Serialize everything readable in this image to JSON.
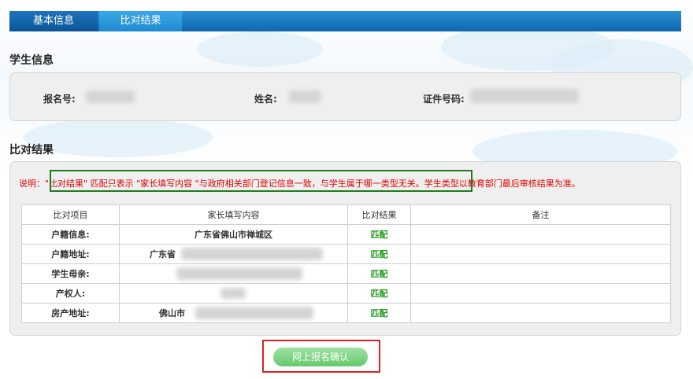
{
  "tabs": {
    "basic_info": "基本信息",
    "compare_result": "比对结果"
  },
  "student_info": {
    "title": "学生信息",
    "reg_no_label": "报名号:",
    "name_label": "姓名:",
    "id_label": "证件号码:"
  },
  "compare": {
    "title": "比对结果",
    "notice_prefix": "说明：",
    "notice_highlight": "\"比对结果\" 匹配只表示 \"家长填写内容 \"与政府相关部门登记信息一致，与学生属于哪一类型无关。",
    "notice_suffix": "学生类型以教育部门最后审核结果为准。",
    "headers": [
      "比对项目",
      "家长填写内容",
      "比对结果",
      "备注"
    ],
    "rows": [
      {
        "item": "户籍信息:",
        "content": "广东省佛山市禅城区",
        "result": "匹配",
        "note": ""
      },
      {
        "item": "户籍地址:",
        "content": "广东省",
        "result": "匹配",
        "note": ""
      },
      {
        "item": "学生母亲:",
        "content": "",
        "result": "匹配",
        "note": ""
      },
      {
        "item": "产权人:",
        "content": "",
        "result": "匹配",
        "note": ""
      },
      {
        "item": "房产地址:",
        "content": "佛山市",
        "result": "匹配",
        "note": ""
      }
    ]
  },
  "confirm_button": "网上报名确认",
  "colors": {
    "tab_bar": "#0f66b0",
    "notice_text": "#e00000",
    "highlight_border": "#1f7a1f",
    "match_text": "#1e9a1e",
    "confirm_button": "#63c96b",
    "confirm_outline": "#e02020"
  }
}
